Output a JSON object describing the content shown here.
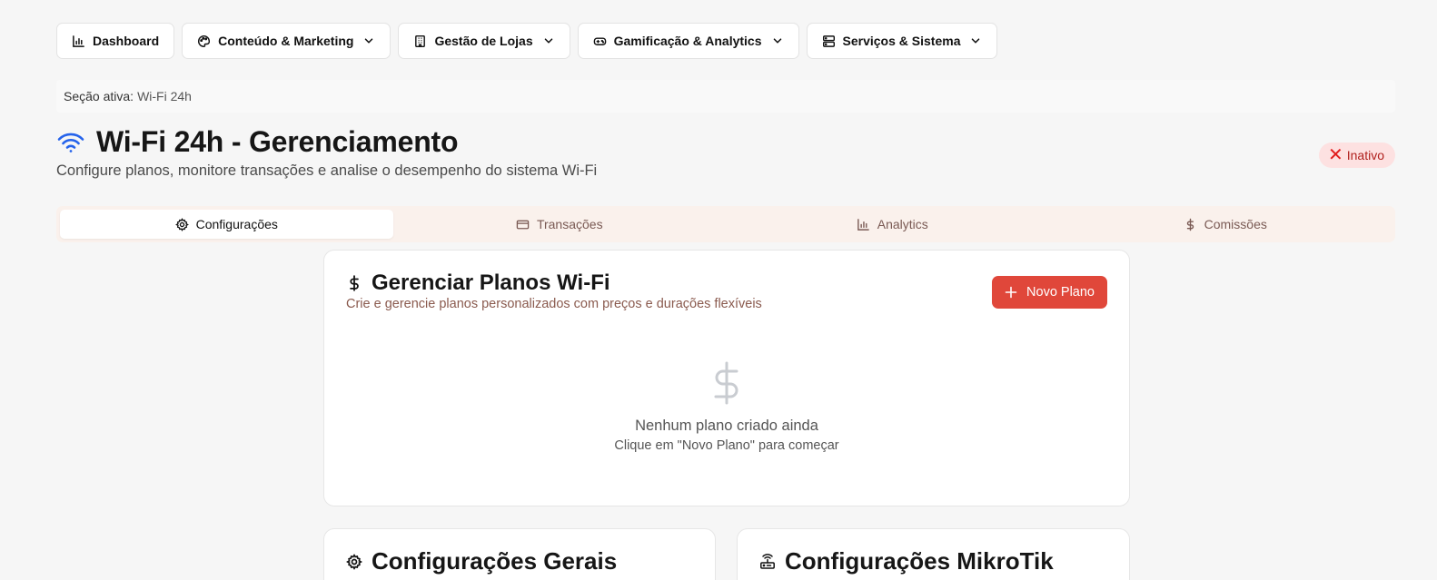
{
  "nav": {
    "items": [
      {
        "label": "Dashboard",
        "icon": "bar-chart-icon",
        "dropdown": false
      },
      {
        "label": "Conteúdo & Marketing",
        "icon": "palette-icon",
        "dropdown": true
      },
      {
        "label": "Gestão de Lojas",
        "icon": "building-icon",
        "dropdown": true
      },
      {
        "label": "Gamificação & Analytics",
        "icon": "gamepad-icon",
        "dropdown": true
      },
      {
        "label": "Serviços & Sistema",
        "icon": "server-icon",
        "dropdown": true
      }
    ]
  },
  "active_section": {
    "label": "Seção ativa:",
    "value": "Wi-Fi 24h"
  },
  "header": {
    "title": "Wi-Fi 24h - Gerenciamento",
    "subtitle": "Configure planos, monitore transações e analise o desempenho do sistema Wi-Fi",
    "status": "Inativo",
    "accent_color": "#2563eb"
  },
  "tabs": [
    {
      "label": "Configurações",
      "icon": "gear-icon",
      "active": true
    },
    {
      "label": "Transações",
      "icon": "credit-card-icon",
      "active": false
    },
    {
      "label": "Analytics",
      "icon": "bar-chart-icon",
      "active": false
    },
    {
      "label": "Comissões",
      "icon": "dollar-icon",
      "active": false
    }
  ],
  "plans_card": {
    "title": "Gerenciar Planos Wi-Fi",
    "description": "Crie e gerencie planos personalizados com preços e durações flexíveis",
    "new_plan_label": "Novo Plano",
    "empty_title": "Nenhum plano criado ainda",
    "empty_hint": "Clique em \"Novo Plano\" para começar",
    "button_color": "#e0473a"
  },
  "general_card": {
    "title": "Configurações Gerais"
  },
  "mikrotik_card": {
    "title": "Configurações MikroTik"
  }
}
